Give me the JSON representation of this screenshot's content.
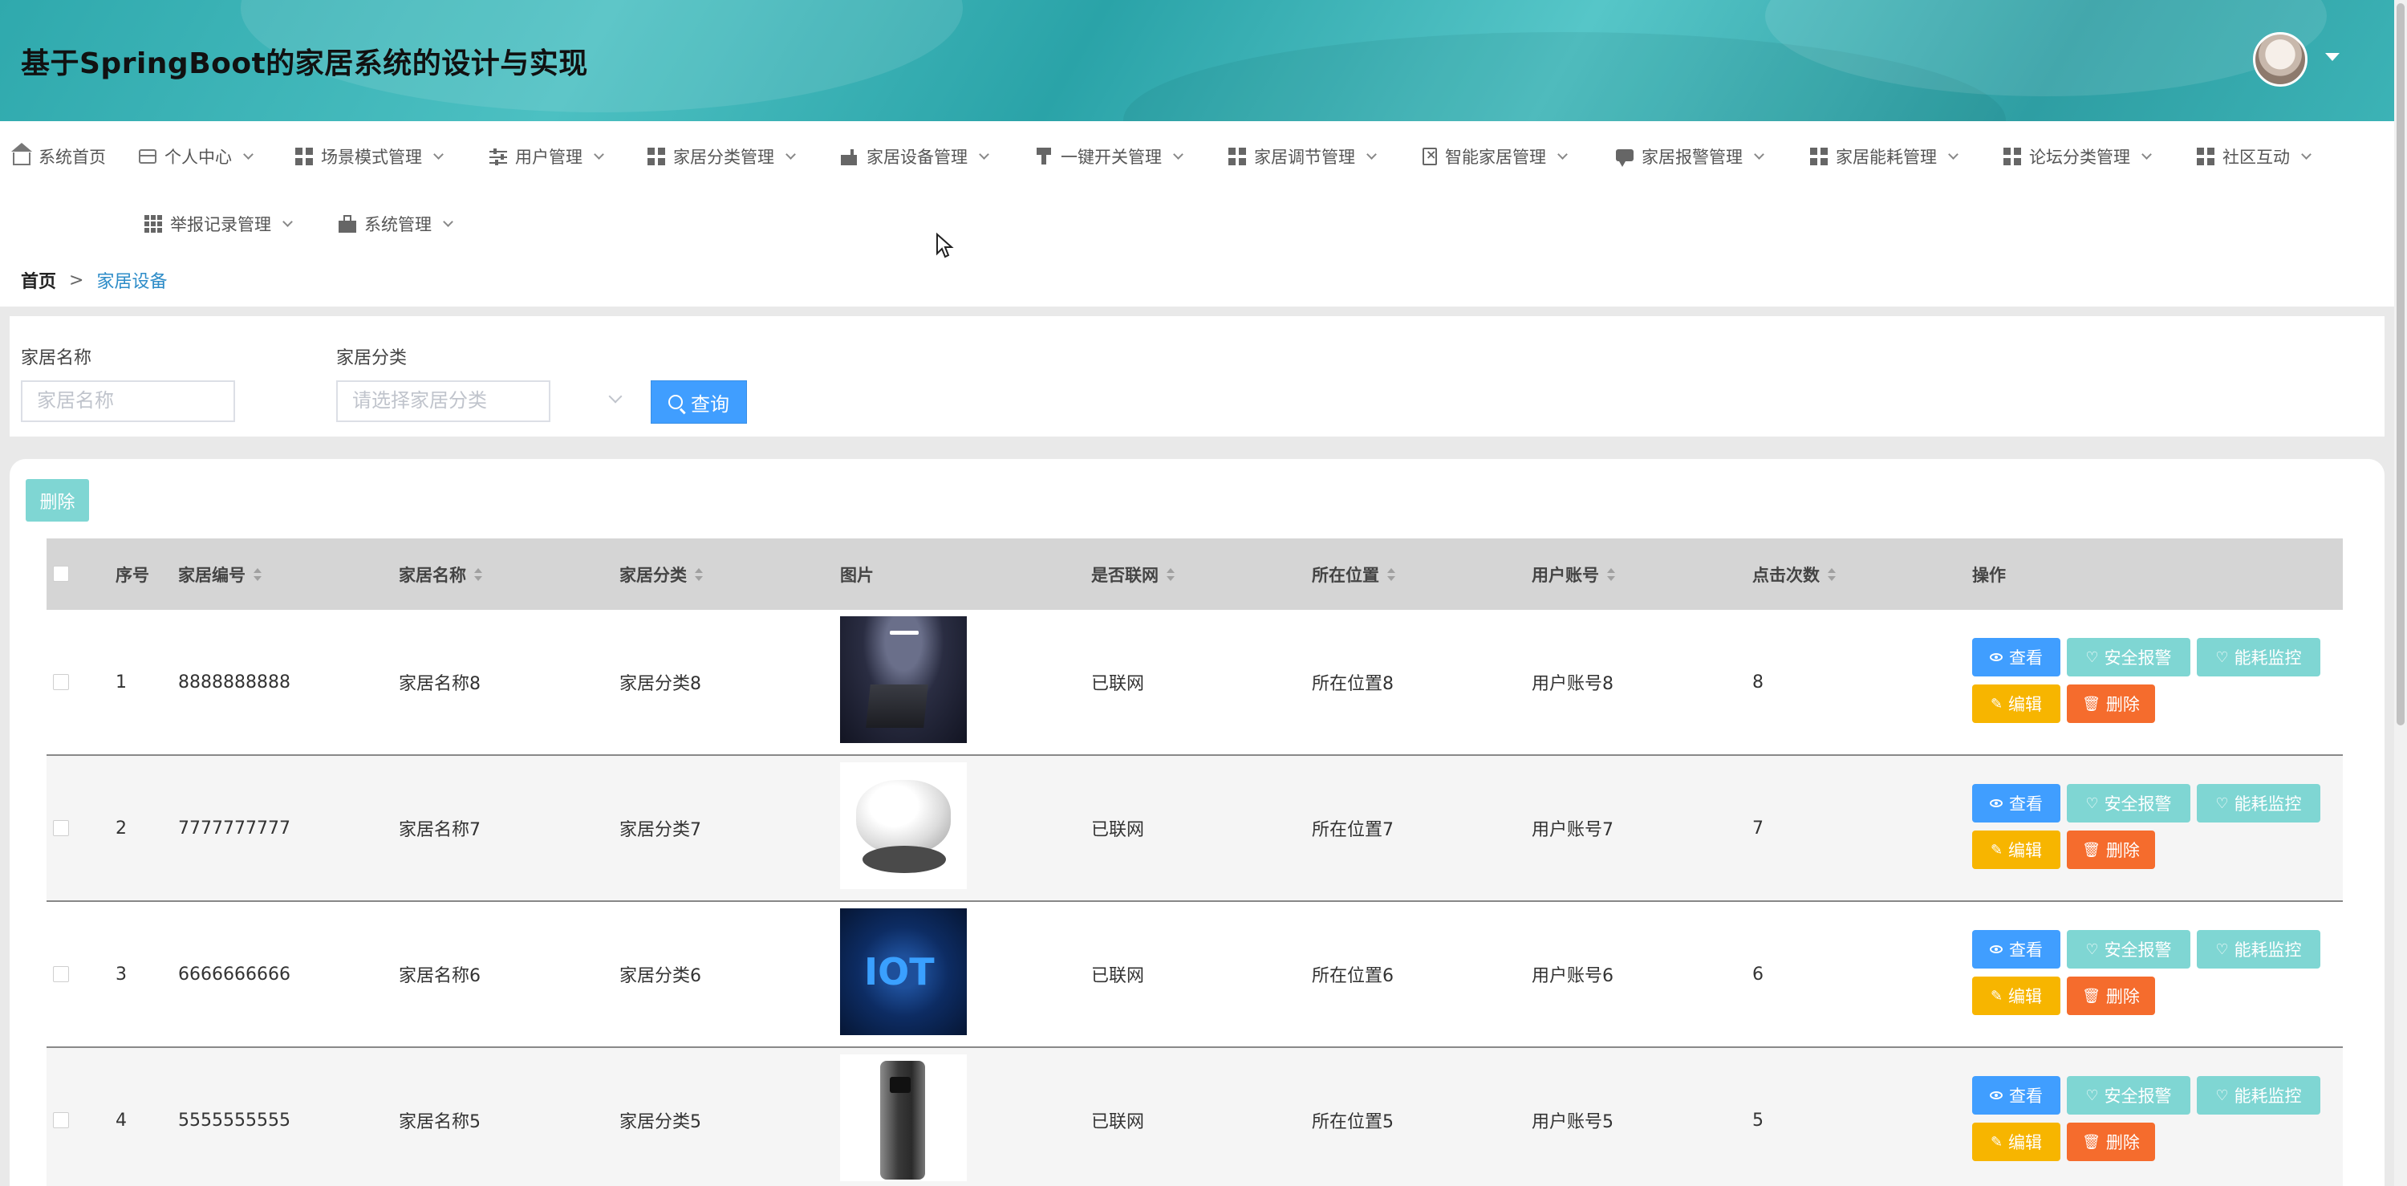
{
  "app": {
    "title": "基于SpringBoot的家居系统的设计与实现"
  },
  "nav": {
    "items": [
      {
        "label": "系统首页",
        "icon": "home-icon"
      },
      {
        "label": "个人中心",
        "icon": "card-icon"
      },
      {
        "label": "场景模式管理",
        "icon": "grid-icon"
      },
      {
        "label": "用户管理",
        "icon": "sliders-icon"
      },
      {
        "label": "家居分类管理",
        "icon": "grid-icon"
      },
      {
        "label": "家居设备管理",
        "icon": "device-icon"
      },
      {
        "label": "一键开关管理",
        "icon": "switch-icon"
      },
      {
        "label": "家居调节管理",
        "icon": "grid-icon"
      },
      {
        "label": "智能家居管理",
        "icon": "clipboard-icon"
      },
      {
        "label": "家居报警管理",
        "icon": "chat-icon"
      },
      {
        "label": "家居能耗管理",
        "icon": "grid-icon"
      },
      {
        "label": "论坛分类管理",
        "icon": "grid-icon"
      },
      {
        "label": "社区互动",
        "icon": "grid-icon"
      },
      {
        "label": "举报记录管理",
        "icon": "grid9-icon"
      },
      {
        "label": "系统管理",
        "icon": "briefcase-icon"
      }
    ]
  },
  "breadcrumb": {
    "home": "首页",
    "separator": ">",
    "current": "家居设备"
  },
  "search": {
    "name_label": "家居名称",
    "name_placeholder": "家居名称",
    "category_label": "家居分类",
    "category_placeholder": "请选择家居分类",
    "query_label": "查询"
  },
  "toolbar": {
    "delete_label": "删除"
  },
  "table": {
    "headers": {
      "index": "序号",
      "code": "家居编号",
      "name": "家居名称",
      "category": "家居分类",
      "image": "图片",
      "online": "是否联网",
      "location": "所在位置",
      "account": "用户账号",
      "clicks": "点击次数",
      "actions": "操作"
    },
    "actions": {
      "view": "查看",
      "safety": "安全报警",
      "energy": "能耗监控",
      "edit": "编辑",
      "delete": "删除"
    },
    "rows": [
      {
        "index": "1",
        "code": "8888888888",
        "name": "家居名称8",
        "category": "家居分类8",
        "image": "speaker-product-image",
        "online": "已联网",
        "location": "所在位置8",
        "account": "用户账号8",
        "clicks": "8"
      },
      {
        "index": "2",
        "code": "7777777777",
        "name": "家居名称7",
        "category": "家居分类7",
        "image": "window-robot-image",
        "online": "已联网",
        "location": "所在位置7",
        "account": "用户账号7",
        "clicks": "7"
      },
      {
        "index": "3",
        "code": "6666666666",
        "name": "家居名称6",
        "category": "家居分类6",
        "image": "iot-poster-image",
        "online": "已联网",
        "location": "所在位置6",
        "account": "用户账号6",
        "clicks": "6"
      },
      {
        "index": "4",
        "code": "5555555555",
        "name": "家居名称5",
        "category": "家居分类5",
        "image": "smart-lock-image",
        "online": "已联网",
        "location": "所在位置5",
        "account": "用户账号5",
        "clicks": "5"
      }
    ]
  },
  "colors": {
    "primary": "#409eff",
    "teal": "#7fd6d3",
    "warning": "#f7b500",
    "danger": "#f56c2d",
    "header_bg": "#3cb3b6"
  }
}
